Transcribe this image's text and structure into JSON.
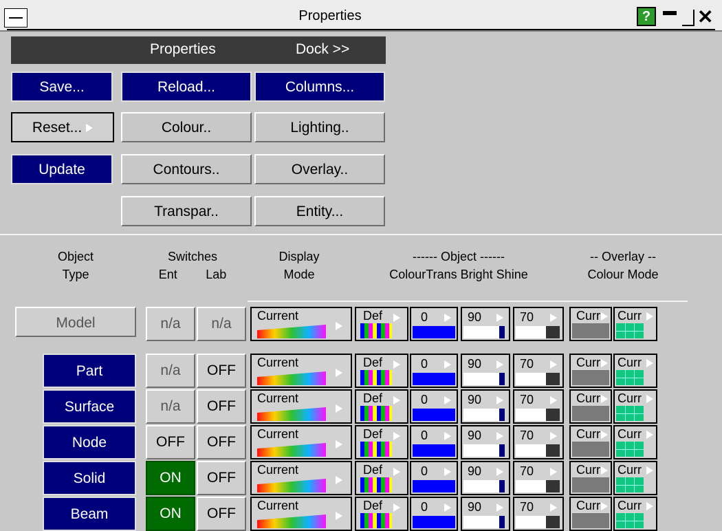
{
  "window": {
    "title": "Properties",
    "help_label": "?"
  },
  "panel": {
    "title": "Properties",
    "dock_label": "Dock >>"
  },
  "buttons": {
    "save": "Save...",
    "reload": "Reload...",
    "columns": "Columns...",
    "reset": "Reset...",
    "colour": "Colour..",
    "lighting": "Lighting..",
    "update": "Update",
    "contours": "Contours..",
    "overlay": "Overlay..",
    "transpar": "Transpar..",
    "entity": "Entity..."
  },
  "headers": {
    "object_type": [
      "Object",
      "Type"
    ],
    "switches": [
      "Switches",
      "Ent",
      "Lab"
    ],
    "display_mode": [
      "Display",
      "Mode"
    ],
    "object_group": "------ Object ------",
    "object_cols": "ColourTrans Bright Shine",
    "overlay_group": "-- Overlay --",
    "overlay_cols": "Colour Mode"
  },
  "rows": [
    {
      "type": "Model",
      "ent": "n/a",
      "lab": "n/a",
      "display": "Current",
      "colour": "Def",
      "trans": "0",
      "bright": "90",
      "shine": "70",
      "ov_colour": "Curr",
      "ov_mode": "Curr"
    },
    {
      "type": "Part",
      "ent": "n/a",
      "lab": "OFF",
      "display": "Current",
      "colour": "Def",
      "trans": "0",
      "bright": "90",
      "shine": "70",
      "ov_colour": "Curr",
      "ov_mode": "Curr"
    },
    {
      "type": "Surface",
      "ent": "n/a",
      "lab": "OFF",
      "display": "Current",
      "colour": "Def",
      "trans": "0",
      "bright": "90",
      "shine": "70",
      "ov_colour": "Curr",
      "ov_mode": "Curr"
    },
    {
      "type": "Node",
      "ent": "OFF",
      "lab": "OFF",
      "display": "Current",
      "colour": "Def",
      "trans": "0",
      "bright": "90",
      "shine": "70",
      "ov_colour": "Curr",
      "ov_mode": "Curr"
    },
    {
      "type": "Solid",
      "ent": "ON",
      "lab": "OFF",
      "display": "Current",
      "colour": "Def",
      "trans": "0",
      "bright": "90",
      "shine": "70",
      "ov_colour": "Curr",
      "ov_mode": "Curr"
    },
    {
      "type": "Beam",
      "ent": "ON",
      "lab": "OFF",
      "display": "Current",
      "colour": "Def",
      "trans": "0",
      "bright": "90",
      "shine": "70",
      "ov_colour": "Curr",
      "ov_mode": "Curr"
    }
  ],
  "colors": {
    "button_blue": "#00007b",
    "on_green": "#006b00",
    "help_green": "#2c9b2c"
  }
}
